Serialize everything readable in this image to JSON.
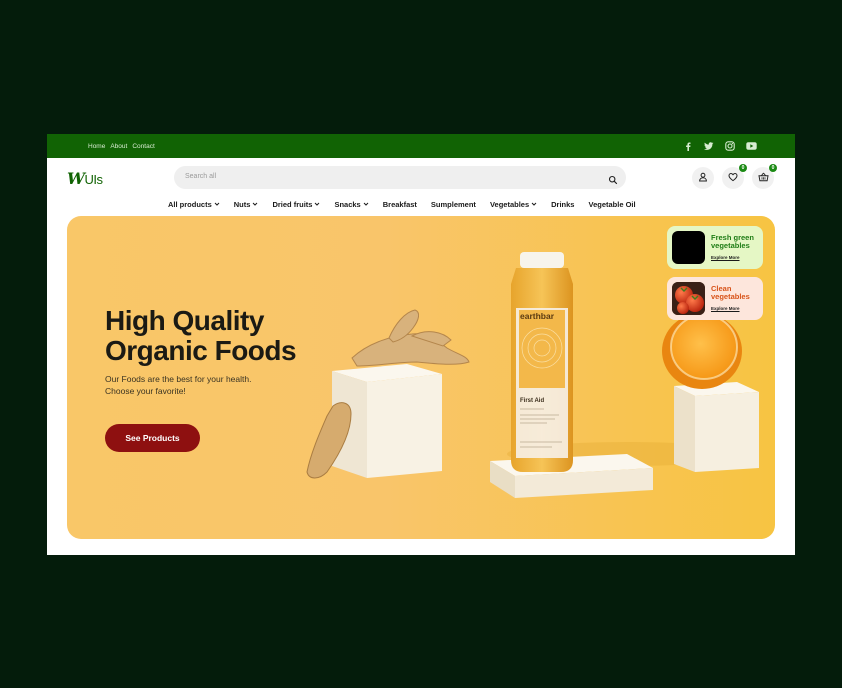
{
  "topbar": {
    "links": [
      "Home",
      "About",
      "Contact"
    ],
    "social_icons": [
      "facebook-icon",
      "twitter-icon",
      "instagram-icon",
      "youtube-icon"
    ]
  },
  "brand": {
    "logo_w": "W",
    "logo_rest": "UIs"
  },
  "search": {
    "placeholder": "Search all"
  },
  "header_icons": {
    "wishlist_count": "0",
    "cart_count": "0"
  },
  "nav": {
    "items": [
      {
        "label": "All products",
        "dropdown": true
      },
      {
        "label": "Nuts",
        "dropdown": true
      },
      {
        "label": "Dried fruits",
        "dropdown": true
      },
      {
        "label": "Snacks",
        "dropdown": true
      },
      {
        "label": "Breakfast",
        "dropdown": false
      },
      {
        "label": "Sumplement",
        "dropdown": false
      },
      {
        "label": "Vegetables",
        "dropdown": true
      },
      {
        "label": "Drinks",
        "dropdown": false
      },
      {
        "label": "Vegetable Oil",
        "dropdown": false
      }
    ]
  },
  "hero": {
    "title_line1": "High Quality",
    "title_line2": "Organic Foods",
    "subtitle_line1": "Our Foods are the best for your health.",
    "subtitle_line2": "Choose your favorite!",
    "cta_label": "See Products",
    "bottle_brand": "earthbar",
    "bottle_flavor": "First Aid"
  },
  "promos": [
    {
      "title": "Fresh green vegetables",
      "link": "Explore More",
      "bg": "#e5f7c5",
      "title_color": "#1f7d16"
    },
    {
      "title": "Clean vegetables",
      "link": "Explore More",
      "bg": "#fde6dc",
      "title_color": "#d85319"
    }
  ],
  "colors": {
    "topbar": "#116304",
    "page_bg": "#041c0b",
    "cta": "#8e1010",
    "hero_bg": "#f9c768"
  }
}
